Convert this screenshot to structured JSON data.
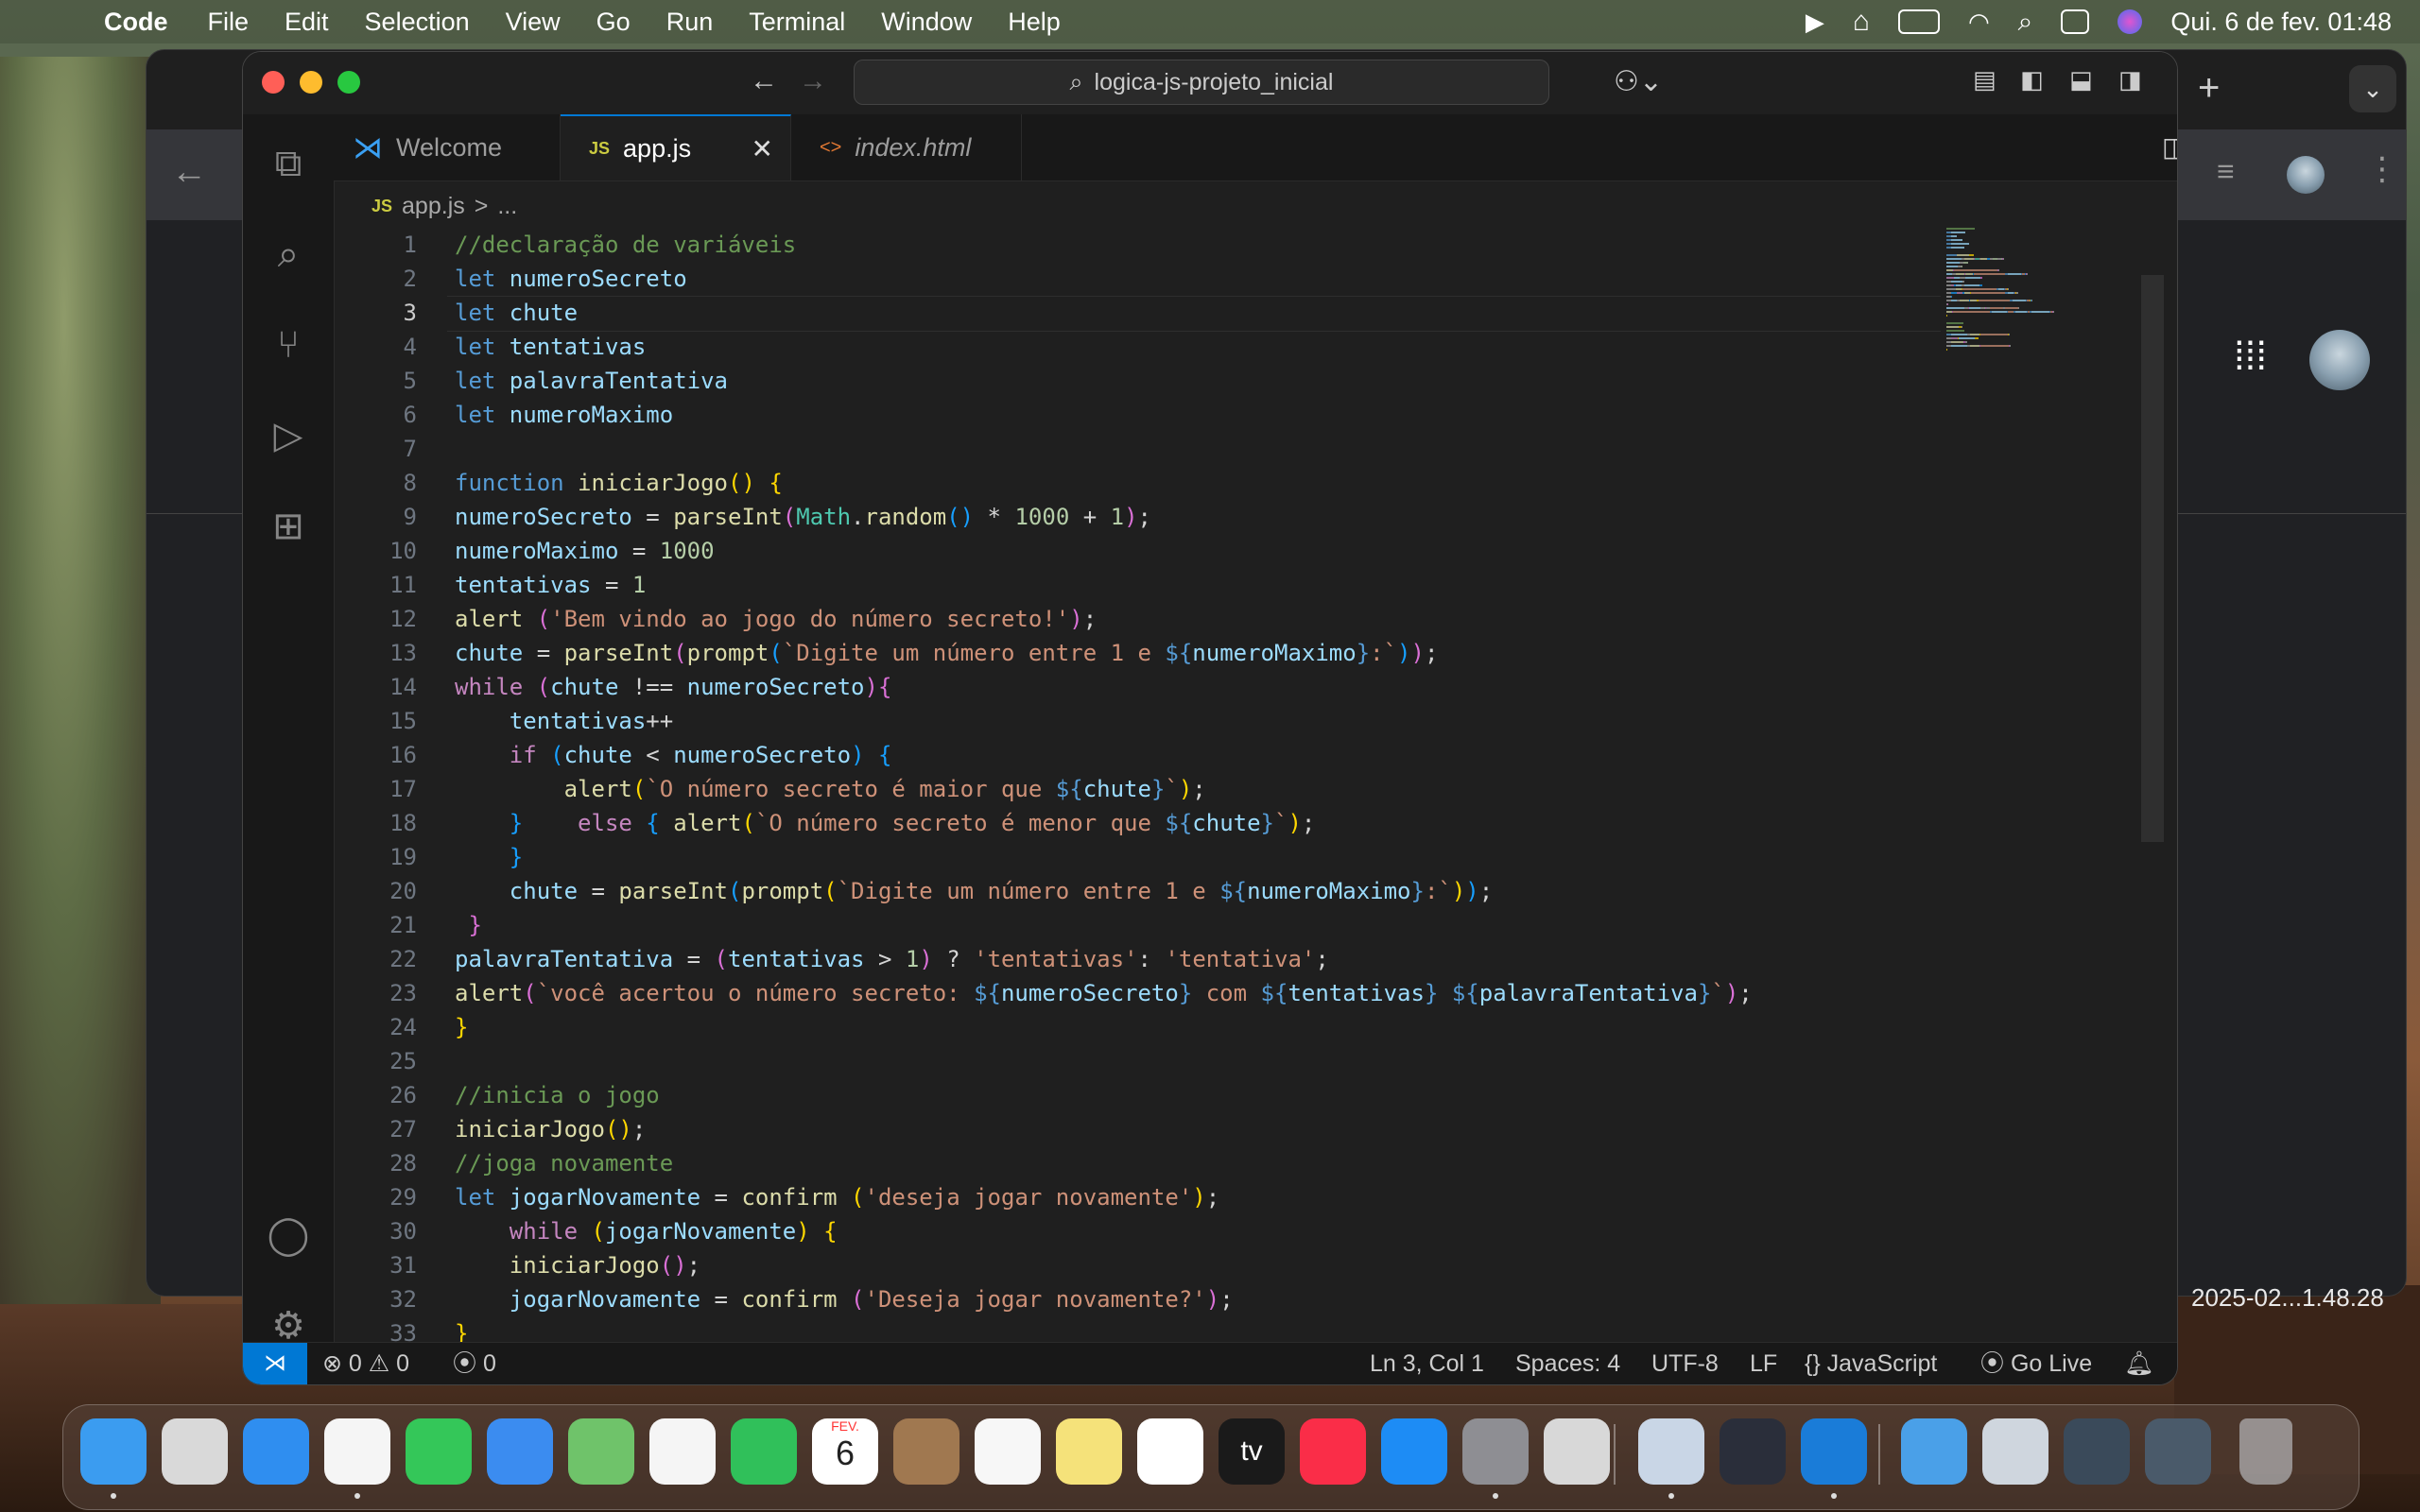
{
  "menubar": {
    "app_name": "Code",
    "items": [
      "File",
      "Edit",
      "Selection",
      "View",
      "Go",
      "Run",
      "Terminal",
      "Window",
      "Help"
    ],
    "datetime": "Qui. 6 de fev.  01:48"
  },
  "background": {
    "timestamp": "2025-02...1.48.28"
  },
  "window": {
    "command_center": "logica-js-projeto_inicial"
  },
  "tabs": [
    {
      "label": "Welcome",
      "icon": "vscode-logo-icon"
    },
    {
      "label": "app.js",
      "icon_text": "JS",
      "active": true
    },
    {
      "label": "index.html",
      "icon_text": "<>",
      "italic": true
    }
  ],
  "breadcrumb": {
    "icon_text": "JS",
    "file": "app.js",
    "sep": ">",
    "rest": "..."
  },
  "editor": {
    "cursor_line": 3,
    "line_numbers": [
      "1",
      "2",
      "3",
      "4",
      "5",
      "6",
      "7",
      "8",
      "9",
      "10",
      "11",
      "12",
      "13",
      "14",
      "15",
      "16",
      "17",
      "18",
      "19",
      "20",
      "21",
      "22",
      "23",
      "24",
      "25",
      "26",
      "27",
      "28",
      "29",
      "30",
      "31",
      "32",
      "33"
    ],
    "lines": [
      [
        [
          "c",
          "//declaração de variáveis"
        ]
      ],
      [
        [
          "k",
          "let "
        ],
        [
          "v",
          "numeroSecreto"
        ]
      ],
      [
        [
          "k",
          "let "
        ],
        [
          "v",
          "chute"
        ]
      ],
      [
        [
          "k",
          "let "
        ],
        [
          "v",
          "tentativas"
        ]
      ],
      [
        [
          "k",
          "let "
        ],
        [
          "v",
          "palavraTentativa"
        ]
      ],
      [
        [
          "k",
          "let "
        ],
        [
          "v",
          "numeroMaximo"
        ]
      ],
      [],
      [
        [
          "k",
          "function "
        ],
        [
          "f",
          "iniciarJogo"
        ],
        [
          "y",
          "() {"
        ]
      ],
      [
        [
          "v",
          "numeroSecreto"
        ],
        [
          "o",
          " = "
        ],
        [
          "f",
          "parseInt"
        ],
        [
          "p",
          "("
        ],
        [
          "t",
          "Math"
        ],
        [
          "o",
          "."
        ],
        [
          "f",
          "random"
        ],
        [
          "b",
          "()"
        ],
        [
          "o",
          " * "
        ],
        [
          "n",
          "1000"
        ],
        [
          "o",
          " + "
        ],
        [
          "n",
          "1"
        ],
        [
          "p",
          ")"
        ],
        [
          "o",
          ";"
        ]
      ],
      [
        [
          "v",
          "numeroMaximo"
        ],
        [
          "o",
          " = "
        ],
        [
          "n",
          "1000"
        ]
      ],
      [
        [
          "v",
          "tentativas"
        ],
        [
          "o",
          " = "
        ],
        [
          "n",
          "1"
        ]
      ],
      [
        [
          "f",
          "alert "
        ],
        [
          "p",
          "("
        ],
        [
          "s",
          "'Bem vindo ao jogo do número secreto!'"
        ],
        [
          "p",
          ")"
        ],
        [
          "o",
          ";"
        ]
      ],
      [
        [
          "v",
          "chute"
        ],
        [
          "o",
          " = "
        ],
        [
          "f",
          "parseInt"
        ],
        [
          "p",
          "("
        ],
        [
          "f",
          "prompt"
        ],
        [
          "b",
          "("
        ],
        [
          "s",
          "`Digite um número entre 1 e "
        ],
        [
          "k",
          "${"
        ],
        [
          "v",
          "numeroMaximo"
        ],
        [
          "k",
          "}"
        ],
        [
          "s",
          ":`"
        ],
        [
          "b",
          ")"
        ],
        [
          "p",
          ")"
        ],
        [
          "o",
          ";"
        ]
      ],
      [
        [
          "ctl",
          "while "
        ],
        [
          "p",
          "("
        ],
        [
          "v",
          "chute"
        ],
        [
          "o",
          " !== "
        ],
        [
          "v",
          "numeroSecreto"
        ],
        [
          "p",
          ")"
        ],
        [
          "p",
          "{"
        ]
      ],
      [
        [
          "o",
          "    "
        ],
        [
          "v",
          "tentativas"
        ],
        [
          "o",
          "++"
        ]
      ],
      [
        [
          "o",
          "    "
        ],
        [
          "ctl",
          "if "
        ],
        [
          "b",
          "("
        ],
        [
          "v",
          "chute"
        ],
        [
          "o",
          " < "
        ],
        [
          "v",
          "numeroSecreto"
        ],
        [
          "b",
          ") {"
        ]
      ],
      [
        [
          "o",
          "        "
        ],
        [
          "f",
          "alert"
        ],
        [
          "y",
          "("
        ],
        [
          "s",
          "`O número secreto é maior que "
        ],
        [
          "k",
          "${"
        ],
        [
          "v",
          "chute"
        ],
        [
          "k",
          "}"
        ],
        [
          "s",
          "`"
        ],
        [
          "y",
          ")"
        ],
        [
          "o",
          ";"
        ]
      ],
      [
        [
          "o",
          "    "
        ],
        [
          "b",
          "}    "
        ],
        [
          "ctl",
          "else "
        ],
        [
          "b",
          "{ "
        ],
        [
          "f",
          "alert"
        ],
        [
          "y",
          "("
        ],
        [
          "s",
          "`O número secreto é menor que "
        ],
        [
          "k",
          "${"
        ],
        [
          "v",
          "chute"
        ],
        [
          "k",
          "}"
        ],
        [
          "s",
          "`"
        ],
        [
          "y",
          ")"
        ],
        [
          "o",
          ";"
        ]
      ],
      [
        [
          "o",
          "    "
        ],
        [
          "b",
          "}"
        ]
      ],
      [
        [
          "o",
          "    "
        ],
        [
          "v",
          "chute"
        ],
        [
          "o",
          " = "
        ],
        [
          "f",
          "parseInt"
        ],
        [
          "b",
          "("
        ],
        [
          "f",
          "prompt"
        ],
        [
          "y",
          "("
        ],
        [
          "s",
          "`Digite um número entre 1 e "
        ],
        [
          "k",
          "${"
        ],
        [
          "v",
          "numeroMaximo"
        ],
        [
          "k",
          "}"
        ],
        [
          "s",
          ":`"
        ],
        [
          "y",
          ")"
        ],
        [
          "b",
          ")"
        ],
        [
          "o",
          ";"
        ]
      ],
      [
        [
          "o",
          " "
        ],
        [
          "p",
          "}"
        ]
      ],
      [
        [
          "v",
          "palavraTentativa"
        ],
        [
          "o",
          " = "
        ],
        [
          "p",
          "("
        ],
        [
          "v",
          "tentativas"
        ],
        [
          "o",
          " > "
        ],
        [
          "n",
          "1"
        ],
        [
          "p",
          ")"
        ],
        [
          "o",
          " ? "
        ],
        [
          "s",
          "'tentativas'"
        ],
        [
          "o",
          ": "
        ],
        [
          "s",
          "'tentativa'"
        ],
        [
          "o",
          ";"
        ]
      ],
      [
        [
          "f",
          "alert"
        ],
        [
          "p",
          "("
        ],
        [
          "s",
          "`você acertou o número secreto: "
        ],
        [
          "k",
          "${"
        ],
        [
          "v",
          "numeroSecreto"
        ],
        [
          "k",
          "}"
        ],
        [
          "s",
          " com "
        ],
        [
          "k",
          "${"
        ],
        [
          "v",
          "tentativas"
        ],
        [
          "k",
          "}"
        ],
        [
          "s",
          " "
        ],
        [
          "k",
          "${"
        ],
        [
          "v",
          "palavraTentativa"
        ],
        [
          "k",
          "}"
        ],
        [
          "s",
          "`"
        ],
        [
          "p",
          ")"
        ],
        [
          "o",
          ";"
        ]
      ],
      [
        [
          "y",
          "}"
        ]
      ],
      [],
      [
        [
          "c",
          "//inicia o jogo"
        ]
      ],
      [
        [
          "f",
          "iniciarJogo"
        ],
        [
          "y",
          "()"
        ],
        [
          "o",
          ";"
        ]
      ],
      [
        [
          "c",
          "//joga novamente"
        ]
      ],
      [
        [
          "k",
          "let "
        ],
        [
          "v",
          "jogarNovamente"
        ],
        [
          "o",
          " = "
        ],
        [
          "f",
          "confirm "
        ],
        [
          "y",
          "("
        ],
        [
          "s",
          "'deseja jogar novamente'"
        ],
        [
          "y",
          ")"
        ],
        [
          "o",
          ";"
        ]
      ],
      [
        [
          "o",
          "    "
        ],
        [
          "ctl",
          "while "
        ],
        [
          "y",
          "("
        ],
        [
          "v",
          "jogarNovamente"
        ],
        [
          "y",
          ") {"
        ]
      ],
      [
        [
          "o",
          "    "
        ],
        [
          "f",
          "iniciarJogo"
        ],
        [
          "p",
          "()"
        ],
        [
          "o",
          ";"
        ]
      ],
      [
        [
          "o",
          "    "
        ],
        [
          "v",
          "jogarNovamente"
        ],
        [
          "o",
          " = "
        ],
        [
          "f",
          "confirm "
        ],
        [
          "p",
          "("
        ],
        [
          "s",
          "'Deseja jogar novamente?'"
        ],
        [
          "p",
          ")"
        ],
        [
          "o",
          ";"
        ]
      ],
      [
        [
          "y",
          "}"
        ]
      ]
    ]
  },
  "statusbar": {
    "errors": "0",
    "warnings": "0",
    "ports": "0",
    "position": "Ln 3, Col 1",
    "spaces": "Spaces: 4",
    "encoding": "UTF-8",
    "eol": "LF",
    "language": "JavaScript",
    "golive": "Go Live"
  },
  "dock": {
    "calendar_month": "FEV.",
    "calendar_day": "6",
    "apps": [
      "Finder",
      "Launchpad",
      "Safari",
      "Chrome",
      "Messages",
      "Mail",
      "Maps",
      "Photos",
      "FaceTime",
      "Calendar",
      "Contacts",
      "Reminders",
      "Notes",
      "Freeform",
      "TV",
      "Music",
      "App Store",
      "System Settings",
      "iPhone Mirroring",
      "Preview",
      "DaVinci Resolve",
      "VS Code",
      "Downloads",
      "Screenshots 1",
      "Screenshots 2",
      "Screenshots 3",
      "Trash"
    ],
    "tv_label": "tv"
  },
  "colors": {
    "accent": "#0078d4",
    "editor_bg": "#1f1f1f"
  }
}
